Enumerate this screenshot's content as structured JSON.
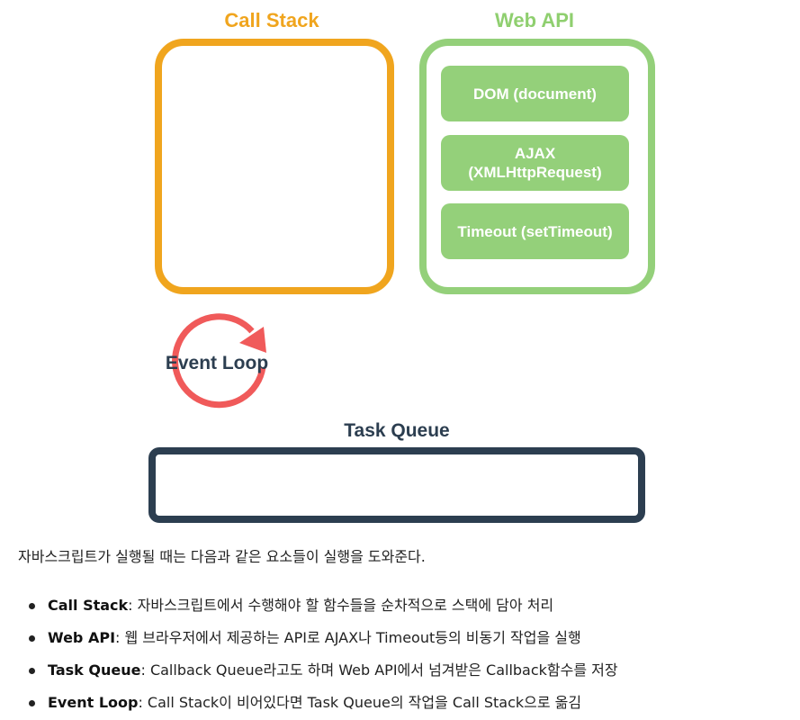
{
  "diagram": {
    "call_stack": {
      "title": "Call Stack",
      "color": "#f0a51e"
    },
    "web_api": {
      "title": "Web API",
      "color": "#94d07a",
      "items": [
        "DOM (document)",
        "AJAX",
        "(XMLHttpRequest)",
        "Timeout (setTimeout)"
      ]
    },
    "event_loop": {
      "label": "Event Loop",
      "color": "#f05a5a"
    },
    "task_queue": {
      "title": "Task Queue",
      "color": "#2c3e50"
    }
  },
  "text": {
    "intro": "자바스크립트가 실행될 때는 다음과 같은 요소들이 실행을 도와준다.",
    "bullets": [
      {
        "term": "Call Stack",
        "desc": ": 자바스크립트에서 수행해야 할 함수들을 순차적으로 스택에 담아 처리"
      },
      {
        "term": "Web API",
        "desc": ": 웹 브라우저에서 제공하는 API로 AJAX나 Timeout등의 비동기 작업을 실행"
      },
      {
        "term": "Task Queue",
        "desc": ": Callback Queue라고도 하며 Web API에서 넘겨받은 Callback함수를 저장"
      },
      {
        "term": "Event Loop",
        "desc": ": Call Stack이 비어있다면 Task Queue의 작업을 Call Stack으로 옮김"
      }
    ]
  }
}
